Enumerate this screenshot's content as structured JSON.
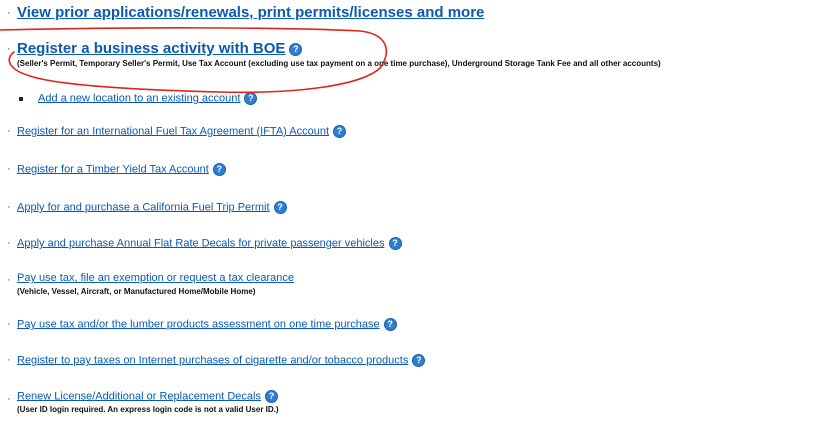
{
  "items": [
    {
      "label": "View prior applications/renewals, print permits/licenses and more"
    },
    {
      "label": "Register a business activity with BOE",
      "sub": "(Seller's Permit, Temporary Seller's Permit, Use Tax Account (excluding use tax payment on a one time purchase), Underground Storage Tank Fee and all other accounts)"
    },
    {
      "label": "Add a new location to an existing account"
    },
    {
      "label": "Register for an International Fuel Tax Agreement (IFTA) Account"
    },
    {
      "label": "Register for a Timber Yield Tax Account"
    },
    {
      "label": "Apply for and purchase a California Fuel Trip Permit"
    },
    {
      "label": "Apply and purchase Annual Flat Rate Decals for private passenger vehicles"
    },
    {
      "label": "Pay use tax, file an exemption or request a tax clearance",
      "sub": "(Vehicle, Vessel, Aircraft, or Manufactured Home/Mobile Home)"
    },
    {
      "label": "Pay use tax and/or the lumber products assessment on one time purchase"
    },
    {
      "label": "Register to pay taxes on Internet purchases of cigarette and/or tobacco products"
    },
    {
      "label": "Renew License/Additional or Replacement Decals",
      "sub": "(User ID login required. An express login code is not a valid User ID.)"
    }
  ],
  "help_glyph": "?",
  "bullet_glyph": "·",
  "colors": {
    "link": "#0b5ab1",
    "help_icon": "#2e7fd3",
    "annotation": "#e0241b"
  }
}
